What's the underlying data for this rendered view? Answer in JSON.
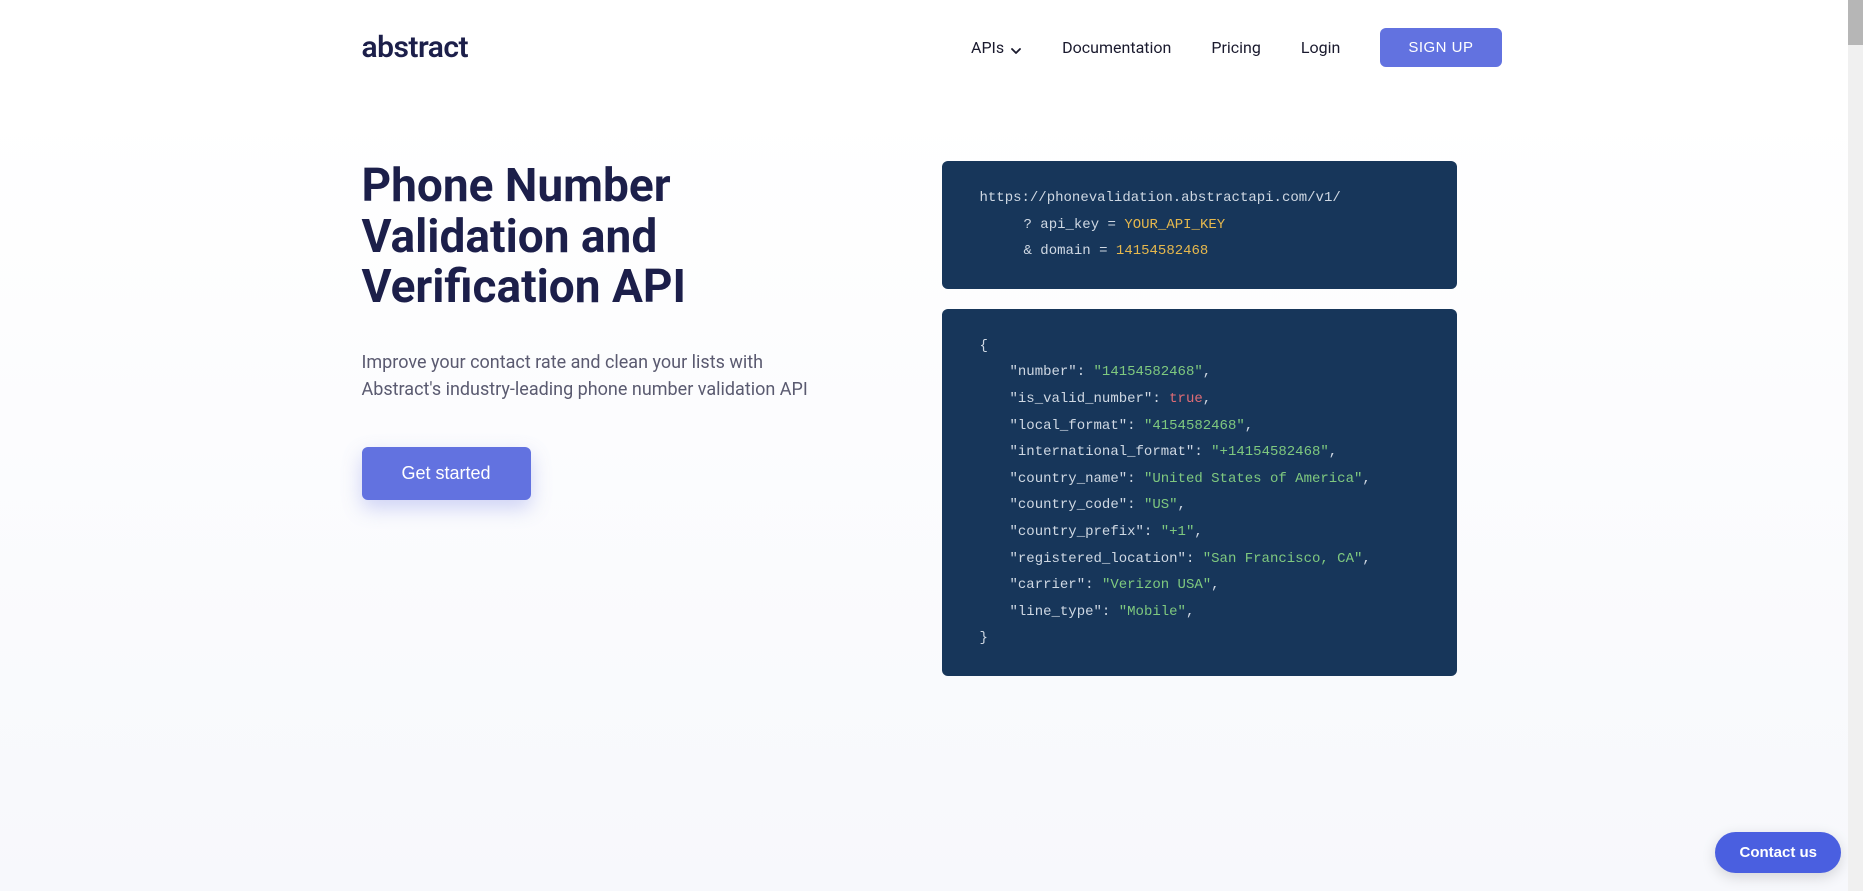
{
  "header": {
    "logo": "abstract",
    "nav": {
      "apis": "APIs",
      "documentation": "Documentation",
      "pricing": "Pricing",
      "login": "Login",
      "signup": "SIGN UP"
    }
  },
  "hero": {
    "title": "Phone Number Validation and Verification API",
    "subtitle": "Improve your contact rate and clean your lists with Abstract's industry-leading phone number validation API",
    "cta": "Get started"
  },
  "request": {
    "url": "https://phonevalidation.abstractapi.com/v1/",
    "line_1_prefix": "? api_key = ",
    "line_1_val": "YOUR_API_KEY",
    "line_2_prefix": "& domain = ",
    "line_2_val": "14154582468"
  },
  "response": {
    "open": "{",
    "close": "}",
    "fields": [
      {
        "k": "\"number\"",
        "v": "\"14154582468\"",
        "t": "str"
      },
      {
        "k": "\"is_valid_number\"",
        "v": "true",
        "t": "bool"
      },
      {
        "k": "\"local_format\"",
        "v": "\"4154582468\"",
        "t": "str"
      },
      {
        "k": "\"international_format\"",
        "v": "\"+14154582468\"",
        "t": "str"
      },
      {
        "k": "\"country_name\"",
        "v": "\"United States of America\"",
        "t": "str"
      },
      {
        "k": "\"country_code\"",
        "v": "\"US\"",
        "t": "str"
      },
      {
        "k": "\"country_prefix\"",
        "v": "\"+1\"",
        "t": "str"
      },
      {
        "k": "\"registered_location\"",
        "v": "\"San Francisco, CA\"",
        "t": "str"
      },
      {
        "k": "\"carrier\"",
        "v": "\"Verizon USA\"",
        "t": "str"
      },
      {
        "k": "\"line_type\"",
        "v": "\"Mobile\"",
        "t": "str"
      }
    ]
  },
  "contact": "Contact us"
}
